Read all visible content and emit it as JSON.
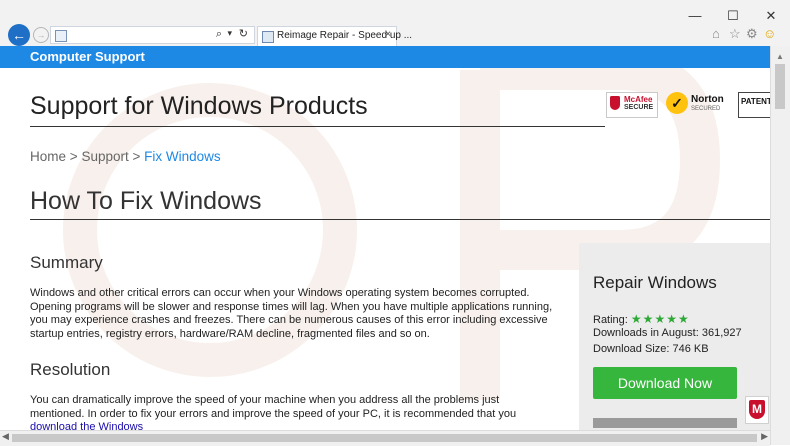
{
  "browser": {
    "tab_title": "Reimage Repair - Speed up ...",
    "tab_close": "×",
    "window_controls": {
      "minimize": "—",
      "maximize": "☐",
      "close": "✕"
    },
    "back_icon": "←",
    "forward_icon": "→",
    "addr_icons": {
      "search": "⌕",
      "dropdown": "▾",
      "refresh": "↻"
    },
    "tool_icons": {
      "home": "⌂",
      "favorites": "☆",
      "settings": "⚙",
      "smiley": "☺"
    }
  },
  "site": {
    "brand": "Computer Support",
    "heading": "Support for Windows Products",
    "badges": {
      "mcafee_1": "McAfee",
      "mcafee_2": "SECURE",
      "norton_1": "Norton",
      "norton_2": "SECURED",
      "norton_check": "✓",
      "patent": "PATENT"
    }
  },
  "breadcrumb": {
    "home": "Home",
    "sep1": ">",
    "support": "Support",
    "sep2": ">",
    "current": "Fix Windows"
  },
  "page": {
    "title": "How To Fix Windows",
    "summary_heading": "Summary",
    "summary_text": "Windows and other critical errors can occur when your Windows operating system becomes corrupted. Opening programs will be slower and response times will lag. When you have multiple applications running, you may experience crashes and freezes. There can be numerous causes of this error including excessive startup entries, registry errors, hardware/RAM decline, fragmented files and so on.",
    "resolution_heading": "Resolution",
    "resolution_text": "You can dramatically improve the speed of your machine when you address all the problems just mentioned. In order to fix your errors and improve the speed of your PC, it is recommended that you ",
    "resolution_link": "download the Windows"
  },
  "sidebar": {
    "title": "Repair Windows",
    "rating_label": "Rating:",
    "stars": "★★★★★",
    "rating_value": 5,
    "downloads": "Downloads in August: 361,927",
    "size": "Download Size: 746 KB",
    "download_button": "Download Now",
    "mcafee_icon_letter": "M"
  },
  "colors": {
    "accent": "#1e88e5",
    "download_green": "#37b63d",
    "stars_green": "#2ea836"
  }
}
